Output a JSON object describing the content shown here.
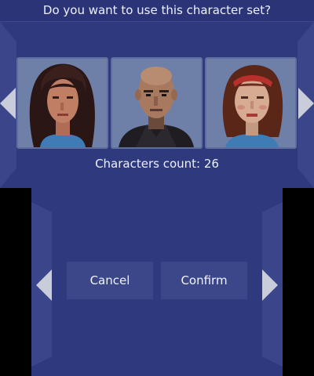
{
  "dialog": {
    "title": "Do you want to use this character set?",
    "characters_count_text": "Characters count: 26"
  },
  "portraits": [
    {
      "name": "character-portrait-woman-dark-hair"
    },
    {
      "name": "character-portrait-bald-man"
    },
    {
      "name": "character-portrait-woman-headband"
    }
  ],
  "buttons": {
    "cancel_label": "Cancel",
    "confirm_label": "Confirm"
  },
  "icons": {
    "previous": "chevron-left-icon",
    "next": "chevron-right-icon"
  },
  "colors": {
    "background": "#2f3a7e",
    "panel": "#3a4689",
    "button": "#3b4788",
    "arrow": "#c9ccd9",
    "text": "#eef0ff"
  }
}
